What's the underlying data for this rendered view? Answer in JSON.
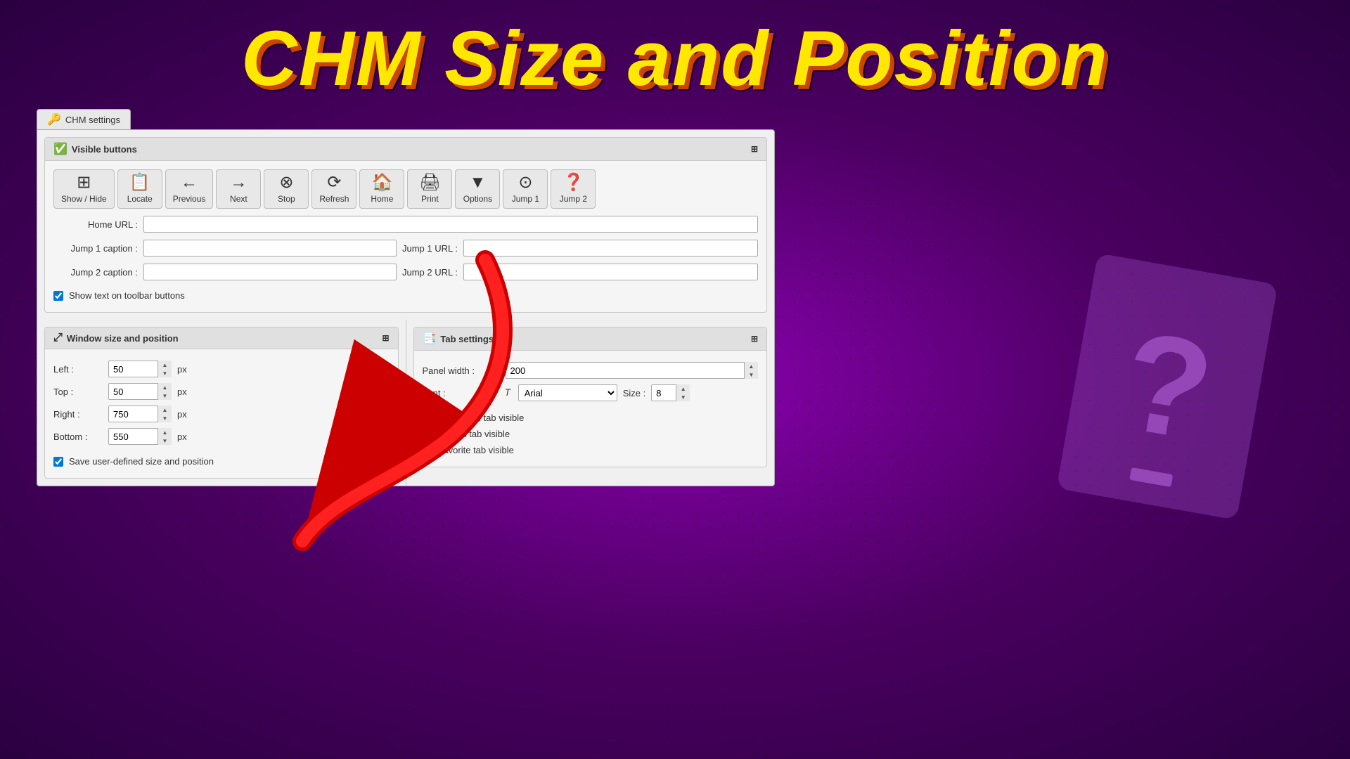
{
  "title": "CHM Size and Position",
  "tab": {
    "icon": "🔑",
    "label": "CHM settings"
  },
  "visible_buttons_section": {
    "icon": "✅",
    "label": "Visible buttons",
    "buttons": [
      {
        "icon": "⊞",
        "label": "Show / Hide",
        "unicode": "🗖"
      },
      {
        "icon": "📋",
        "label": "Locate"
      },
      {
        "icon": "←",
        "label": "Previous"
      },
      {
        "icon": "→",
        "label": "Next"
      },
      {
        "icon": "✕",
        "label": "Stop"
      },
      {
        "icon": "⟳",
        "label": "Refresh"
      },
      {
        "icon": "🏠",
        "label": "Home"
      },
      {
        "icon": "🖨",
        "label": "Print"
      },
      {
        "icon": "▼",
        "label": "Options"
      },
      {
        "icon": "⊙",
        "label": "Jump 1"
      },
      {
        "icon": "❓",
        "label": "Jump 2"
      }
    ],
    "home_url_label": "Home URL :",
    "home_url_value": "",
    "jump1_caption_label": "Jump 1 caption :",
    "jump1_caption_value": "",
    "jump1_url_label": "Jump 1 URL :",
    "jump1_url_value": "",
    "jump2_caption_label": "Jump 2 caption :",
    "jump2_caption_value": "",
    "jump2_url_label": "Jump 2 URL :",
    "jump2_url_value": "",
    "show_text_label": "Show text on toolbar buttons",
    "show_text_checked": true
  },
  "window_size_section": {
    "icon": "⤢",
    "label": "Window size and position",
    "left_label": "Left :",
    "left_value": "50",
    "top_label": "Top :",
    "top_value": "50",
    "right_label": "Right :",
    "right_value": "750",
    "bottom_label": "Bottom :",
    "bottom_value": "550",
    "px": "px",
    "save_label": "Save user-defined size and position",
    "save_checked": true
  },
  "tab_settings_section": {
    "icon": "📑",
    "label": "Tab settings",
    "panel_width_label": "Panel width :",
    "panel_width_value": "200",
    "font_label": "Font :",
    "font_value": "Arial",
    "size_label": "Size :",
    "size_value": "8",
    "nav_tab_label": "Navigation tab visible",
    "nav_tab_checked": true,
    "search_tab_label": "Search tab visible",
    "search_tab_checked": true,
    "favorite_tab_label": "Favorite tab visible",
    "favorite_tab_checked": true
  }
}
